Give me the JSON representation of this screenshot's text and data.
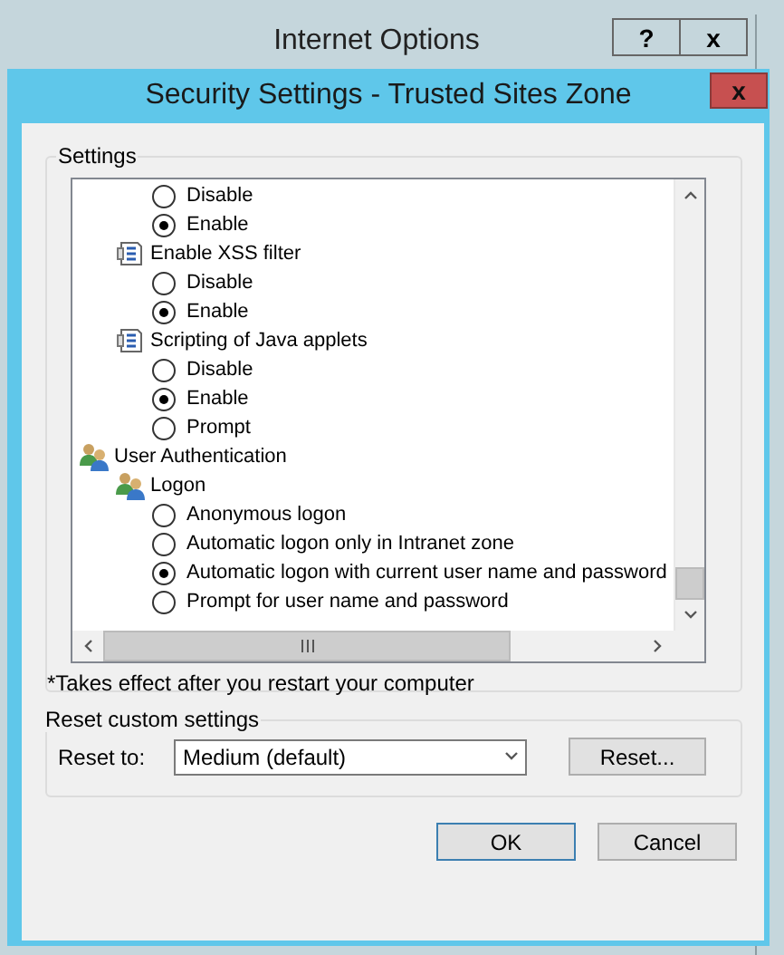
{
  "back_window": {
    "title": "Internet Options",
    "buttons": [
      "?",
      "x"
    ]
  },
  "dialog": {
    "title": "Security Settings - Trusted Sites Zone",
    "close": "x"
  },
  "settings": {
    "label": "Settings",
    "tree": [
      {
        "kind": "group",
        "children": [
          {
            "kind": "group",
            "children": [
              {
                "kind": "radio",
                "label": "Disable",
                "selected": false
              },
              {
                "kind": "radio",
                "label": "Enable",
                "selected": true
              }
            ]
          },
          {
            "kind": "script",
            "label": "Enable XSS filter",
            "children": [
              {
                "kind": "radio",
                "label": "Disable",
                "selected": false
              },
              {
                "kind": "radio",
                "label": "Enable",
                "selected": true
              }
            ]
          },
          {
            "kind": "script",
            "label": "Scripting of Java applets",
            "children": [
              {
                "kind": "radio",
                "label": "Disable",
                "selected": false
              },
              {
                "kind": "radio",
                "label": "Enable",
                "selected": true
              },
              {
                "kind": "radio",
                "label": "Prompt",
                "selected": false
              }
            ]
          }
        ]
      },
      {
        "kind": "users",
        "label": "User Authentication",
        "children": [
          {
            "kind": "users",
            "label": "Logon",
            "children": [
              {
                "kind": "radio",
                "label": "Anonymous logon",
                "selected": false
              },
              {
                "kind": "radio",
                "label": "Automatic logon only in Intranet zone",
                "selected": false
              },
              {
                "kind": "radio",
                "label": "Automatic logon with current user name and password",
                "selected": true
              },
              {
                "kind": "radio",
                "label": "Prompt for user name and password",
                "selected": false
              }
            ]
          }
        ]
      }
    ],
    "note": "*Takes effect after you restart your computer"
  },
  "reset": {
    "label": "Reset custom settings",
    "field_label": "Reset to:",
    "dropdown": {
      "value": "Medium (default)"
    },
    "button": "Reset..."
  },
  "buttons": [
    {
      "label": "OK",
      "default": true
    },
    {
      "label": "Cancel",
      "default": false
    }
  ]
}
